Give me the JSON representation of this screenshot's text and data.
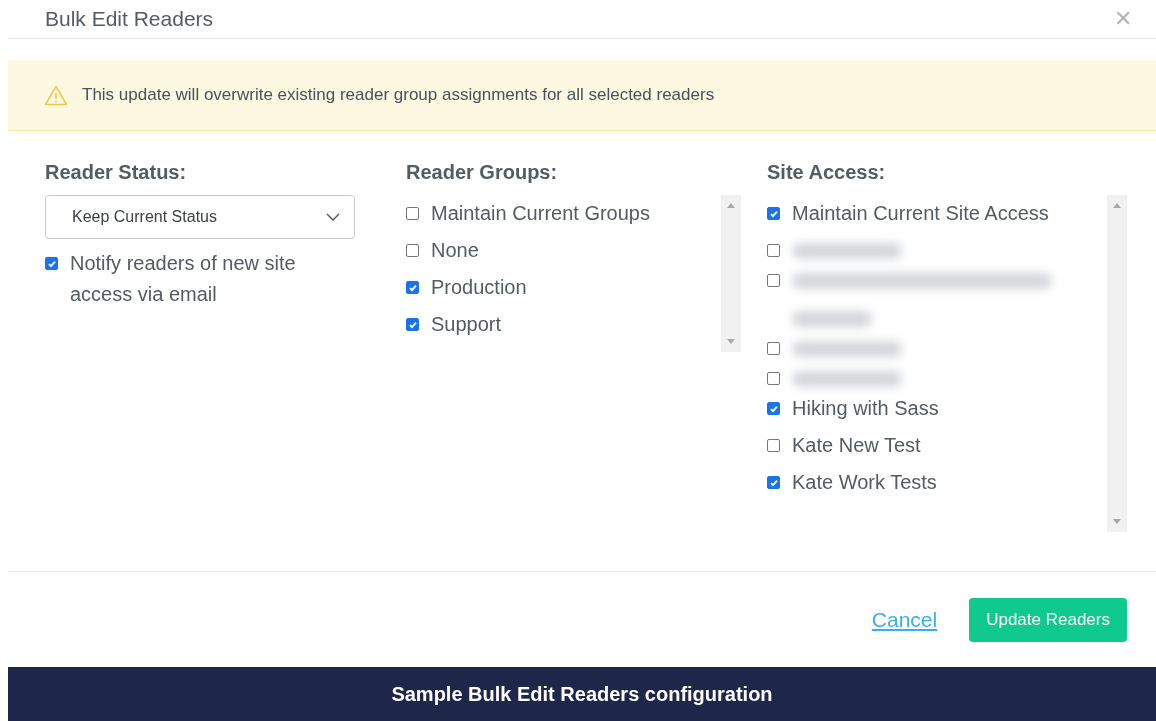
{
  "dialog": {
    "title": "Bulk Edit Readers",
    "close": "✕"
  },
  "warning": {
    "text": "This update will overwrite existing reader group assignments for all selected readers"
  },
  "reader_status": {
    "heading": "Reader Status:",
    "select": {
      "value": "Keep Current Status"
    },
    "notify": {
      "label": "Notify readers of new site access via email",
      "checked": true
    }
  },
  "reader_groups": {
    "heading": "Reader Groups:",
    "items": [
      {
        "kind": "option",
        "label": "Maintain Current Groups",
        "checked": false
      },
      {
        "kind": "option",
        "label": "None",
        "checked": false
      },
      {
        "kind": "option",
        "label": "Production",
        "checked": true
      },
      {
        "kind": "option",
        "label": "Support",
        "checked": true
      }
    ]
  },
  "site_access": {
    "heading": "Site Access:",
    "items": [
      {
        "kind": "option",
        "label": "Maintain Current Site Access",
        "checked": true
      },
      {
        "kind": "redacted",
        "checked": false
      },
      {
        "kind": "redacted-wrap",
        "checked": false
      },
      {
        "kind": "redacted",
        "checked": false
      },
      {
        "kind": "redacted",
        "checked": false
      },
      {
        "kind": "option",
        "label": "Hiking with Sass",
        "checked": true
      },
      {
        "kind": "option",
        "label": "Kate New Test",
        "checked": false
      },
      {
        "kind": "option",
        "label": "Kate Work Tests",
        "checked": true
      }
    ]
  },
  "footer": {
    "cancel": "Cancel",
    "submit": "Update Readers"
  },
  "caption": "Sample Bulk Edit Readers configuration"
}
